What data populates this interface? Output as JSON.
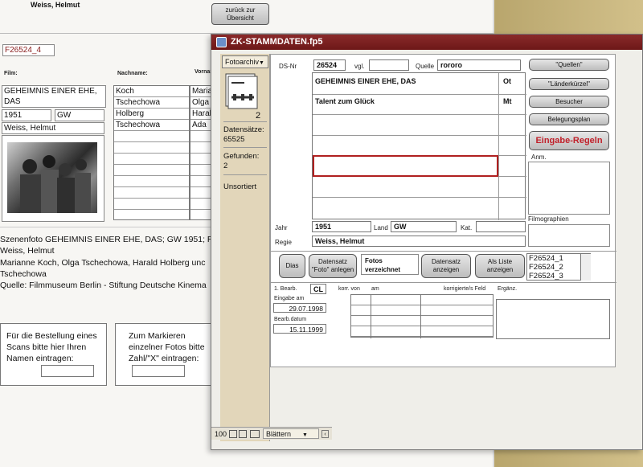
{
  "background": {
    "header_name": "Weiss, Helmut",
    "back_button": "zurück zur Übersicht",
    "record_id": "F26524_4",
    "labels": {
      "film": "Film:",
      "nachname": "Nachname:",
      "vorname": "Vorname:"
    },
    "film_title": "GEHEIMNIS EINER EHE, DAS",
    "year": "1951",
    "country": "GW",
    "director": "Weiss, Helmut",
    "cast": [
      {
        "last": "Koch",
        "first": "Maria"
      },
      {
        "last": "Tschechowa",
        "first": "Olga"
      },
      {
        "last": "Holberg",
        "first": "Haral"
      },
      {
        "last": "Tschechowa",
        "first": "Ada"
      }
    ],
    "caption_lines": [
      "Szenenfoto GEHEIMNIS EINER EHE, DAS; GW 1951; R",
      "Weiss, Helmut",
      "Marianne Koch, Olga Tschechowa, Harald Holberg unc",
      "Tschechowa",
      "Quelle: Filmmuseum Berlin - Stiftung Deutsche Kinema"
    ],
    "order_text": [
      "Für die Bestellung eines",
      "Scans bitte hier Ihren",
      "Namen eintragen:"
    ],
    "mark_text": [
      "Zum Markieren",
      "einzelner Fotos bitte",
      "Zahl/\"X\" eintragen:"
    ]
  },
  "window": {
    "title": "ZK-STAMMDATEN.fp5",
    "sidebar": {
      "layout_menu": "Fotoarchiv",
      "record_number": "2",
      "records_label": "Datensätze:",
      "records_count": "65525",
      "found_label": "Gefunden:",
      "found_count": "2",
      "sort_status": "Unsortiert",
      "zoom": "100",
      "mode": "Blättern"
    },
    "form": {
      "ds_label": "DS-Nr",
      "ds_value": "26524",
      "vgl_label": "vgl.",
      "vgl_value": "",
      "quelle_label": "Quelle",
      "quelle_value": "rororo",
      "titles": [
        {
          "title": "GEHEIMNIS EINER EHE, DAS",
          "code": "Ot"
        },
        {
          "title": "Talent zum Glück",
          "code": "Mt"
        }
      ],
      "jahr_label": "Jahr",
      "jahr_value": "1951",
      "land_label": "Land",
      "land_value": "GW",
      "kat_label": "Kat.",
      "regie_label": "Regie",
      "regie_value": "Weiss, Helmut",
      "anm_label": "Anm.",
      "filmographien_label": "Filmographien",
      "buttons": {
        "quellen": "\"Quellen\"",
        "laenderkuerzel": "\"Länderkürzel\"",
        "besucher": "Besucher",
        "belegungsplan": "Belegungsplan",
        "eingabe_regeln": "Eingabe-Regeln",
        "dias": "Dias",
        "datensatz_foto": "Datensatz \"Foto\" anlegen",
        "datensatz_anzeigen": "Datensatz anzeigen",
        "als_liste": "Als Liste anzeigen"
      },
      "fotos_label": "Fotos verzeichnet",
      "photo_ids": [
        "F26524_1",
        "F26524_2",
        "F26524_3"
      ],
      "bearb_label": "1. Bearb.",
      "bearb_value": "CL",
      "eingabe_label": "Eingabe am",
      "eingabe_value": "29.07.1998",
      "bearb_datum_label": "Bearb.datum",
      "bearb_datum_value": "15.11.1999",
      "korr_von_label": "korr. von",
      "am_label": "am",
      "korr_feld_label": "korrigierte/s Feld",
      "ergaenz_label": "Ergänz."
    }
  }
}
